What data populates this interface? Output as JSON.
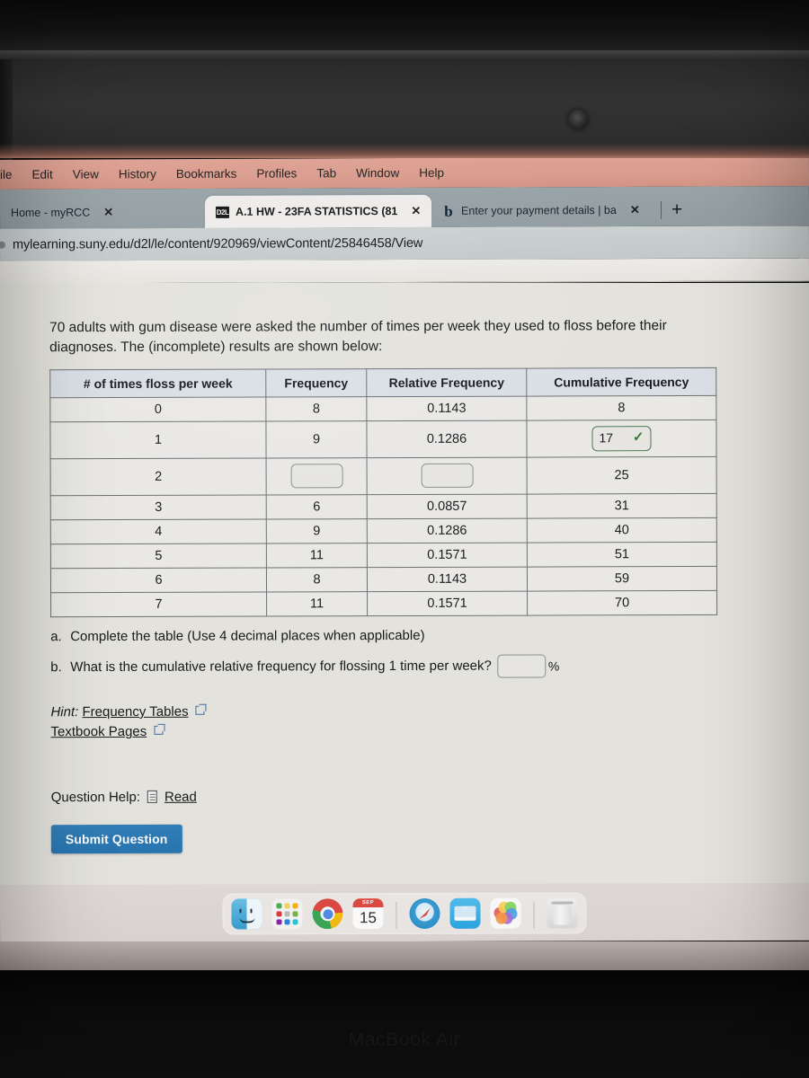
{
  "device": {
    "brand_label": "MacBook Air"
  },
  "menubar": {
    "items": [
      "ile",
      "Edit",
      "View",
      "History",
      "Bookmarks",
      "Profiles",
      "Tab",
      "Window",
      "Help"
    ]
  },
  "browser": {
    "tabs": [
      {
        "title": "Home - myRCC",
        "favicon": "none",
        "active": false,
        "close_label": "✕"
      },
      {
        "title": "A.1 HW - 23FA STATISTICS (81",
        "favicon": "d2l-icon",
        "favicon_text": "D2L",
        "active": true,
        "close_label": "✕"
      },
      {
        "title": "Enter your payment details | ba",
        "favicon": "bold-b-icon",
        "favicon_text": "b",
        "active": false,
        "close_label": "✕"
      }
    ],
    "new_tab_label": "+",
    "url": "mylearning.suny.edu/d2l/le/content/920969/viewContent/25846458/View"
  },
  "question": {
    "prompt": "70 adults with gum disease were asked the number of times per week they used to floss before their diagnoses. The (incomplete) results are shown below:",
    "part_a": {
      "label": "a.",
      "text": "Complete the table (Use 4 decimal places when applicable)"
    },
    "part_b": {
      "label": "b.",
      "text": "What is the cumulative relative frequency for flossing 1 time per week?",
      "input_value": "",
      "unit": "%"
    },
    "hint": {
      "prefix": "Hint:",
      "links": [
        "Frequency Tables",
        "Textbook Pages"
      ]
    },
    "help": {
      "label": "Question Help:",
      "link": "Read"
    },
    "submit_label": "Submit Question"
  },
  "table": {
    "headers": [
      "# of times floss per week",
      "Frequency",
      "Relative Frequency",
      "Cumulative Frequency"
    ],
    "rows": [
      {
        "x": "0",
        "frequency": "8",
        "relative": "0.1143",
        "cumulative": "8",
        "freq_input": false,
        "rel_input": false,
        "cum_input": false
      },
      {
        "x": "1",
        "frequency": "9",
        "relative": "0.1286",
        "cumulative": "17",
        "freq_input": false,
        "rel_input": false,
        "cum_input": true,
        "cum_validated": true,
        "check_mark": "✓"
      },
      {
        "x": "2",
        "frequency": "",
        "relative": "",
        "cumulative": "25",
        "freq_input": true,
        "rel_input": true,
        "cum_input": false
      },
      {
        "x": "3",
        "frequency": "6",
        "relative": "0.0857",
        "cumulative": "31",
        "freq_input": false,
        "rel_input": false,
        "cum_input": false
      },
      {
        "x": "4",
        "frequency": "9",
        "relative": "0.1286",
        "cumulative": "40",
        "freq_input": false,
        "rel_input": false,
        "cum_input": false
      },
      {
        "x": "5",
        "frequency": "11",
        "relative": "0.1571",
        "cumulative": "51",
        "freq_input": false,
        "rel_input": false,
        "cum_input": false
      },
      {
        "x": "6",
        "frequency": "8",
        "relative": "0.1143",
        "cumulative": "59",
        "freq_input": false,
        "rel_input": false,
        "cum_input": false
      },
      {
        "x": "7",
        "frequency": "11",
        "relative": "0.1571",
        "cumulative": "70",
        "freq_input": false,
        "rel_input": false,
        "cum_input": false
      }
    ]
  },
  "dock": {
    "items": [
      {
        "name": "finder-icon",
        "label": "Finder",
        "running": true
      },
      {
        "name": "launchpad-icon",
        "label": "Launchpad",
        "running": false
      },
      {
        "name": "chrome-icon",
        "label": "Google Chrome",
        "running": true
      },
      {
        "name": "calendar-icon",
        "label": "Calendar",
        "month": "SEP",
        "day": "15",
        "running": false
      },
      {
        "name": "safari-icon",
        "label": "Safari",
        "running": false
      },
      {
        "name": "mail-icon",
        "label": "Mail",
        "running": false
      },
      {
        "name": "photos-icon",
        "label": "Photos",
        "running": false
      },
      {
        "name": "trash-icon",
        "label": "Trash",
        "running": false
      }
    ]
  },
  "colors": {
    "accent_button": "#1f76b8",
    "menubar": "#e49e8d",
    "tabstrip": "#93a0a5",
    "page_bg": "#e9e7e1",
    "table_header": "#dfe4ec",
    "validated_green": "#2f7a35"
  }
}
